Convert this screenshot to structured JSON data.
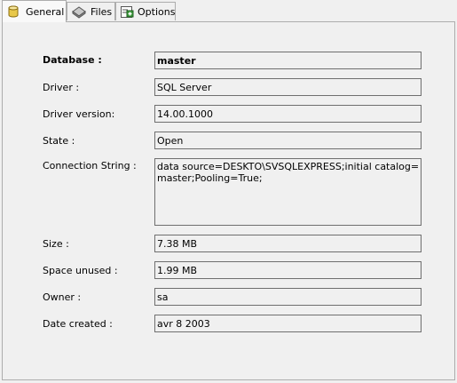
{
  "tabs": [
    {
      "label": "General",
      "icon": "database-icon",
      "active": true
    },
    {
      "label": "Files",
      "icon": "disk-icon",
      "active": false
    },
    {
      "label": "Options",
      "icon": "options-icon",
      "active": false
    }
  ],
  "fields": {
    "database": {
      "label": "Database :",
      "value": "master"
    },
    "driver": {
      "label": "Driver :",
      "value": "SQL Server"
    },
    "driver_version": {
      "label": "Driver version:",
      "value": "14.00.1000"
    },
    "state": {
      "label": "State :",
      "value": "Open"
    },
    "connection_string": {
      "label": "Connection String :",
      "value": "data source=DESKTO\\SVSQLEXPRESS;initial catalog=master;Pooling=True;"
    },
    "size": {
      "label": "Size :",
      "value": "7.38 MB"
    },
    "space_unused": {
      "label": "Space unused :",
      "value": "1.99 MB"
    },
    "owner": {
      "label": "Owner :",
      "value": "sa"
    },
    "date_created": {
      "label": "Date created :",
      "value": "avr  8 2003"
    }
  },
  "colors": {
    "database_icon": "#e8c84a",
    "disk_icon": "#9a9a9a",
    "options_icon": "#3a9a3a"
  }
}
